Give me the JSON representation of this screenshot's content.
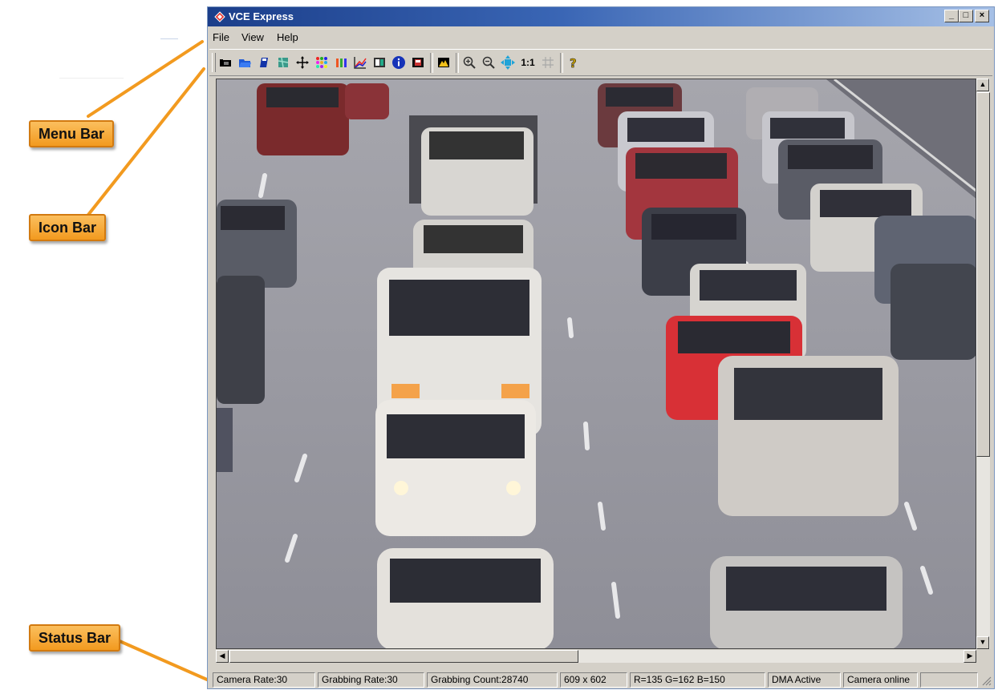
{
  "window": {
    "title": "VCE Express"
  },
  "menu": {
    "items": [
      "File",
      "View",
      "Help"
    ]
  },
  "toolbar": {
    "icons": [
      "camera-icon",
      "folder-open-icon",
      "save-icon",
      "map-icon",
      "move-icon",
      "color-grid-icon",
      "rgb-bars-icon",
      "chart-icon",
      "display-settings-icon",
      "info-icon",
      "film-icon",
      "histogram-icon",
      "zoom-in-icon",
      "zoom-out-icon",
      "fit-window-icon",
      "actual-size-icon",
      "grid-icon",
      "help-icon"
    ],
    "actual_size_label": "1:1"
  },
  "callouts": {
    "menu_bar": "Menu Bar",
    "icon_bar": "Icon Bar",
    "status_bar": "Status Bar"
  },
  "status": {
    "camera_rate": "Camera Rate:30",
    "grabbing_rate": "Grabbing Rate:30",
    "grabbing_count": "Grabbing Count:28740",
    "resolution": "609 x 602",
    "pixel_rgb": "R=135 G=162 B=150",
    "dma": "DMA Active",
    "camera_state": "Camera online"
  },
  "colors": {
    "accent": "#f29a1f",
    "titlebar": "#1b3e8a",
    "chrome": "#d4d0c8"
  }
}
